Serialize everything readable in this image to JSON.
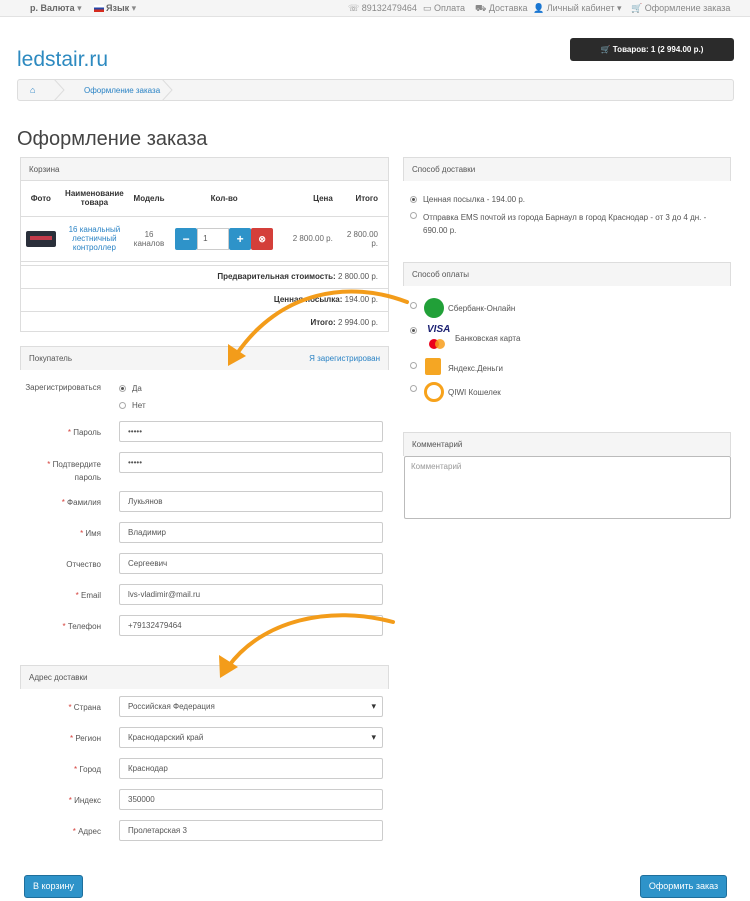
{
  "topbar": {
    "currency_label": "р. Валюта",
    "language_label": "Язык",
    "phone": "89132479464",
    "payment": "Оплата",
    "delivery": "Доставка",
    "account": "Личный кабинет",
    "checkout": "Оформление заказа"
  },
  "header": {
    "logo": "ledstair.ru",
    "cart_button": "Товаров: 1 (2 994.00 р.)"
  },
  "breadcrumb": {
    "current": "Оформление заказа"
  },
  "page_title": "Оформление заказа",
  "cart": {
    "title": "Корзина",
    "columns": [
      "Фото",
      "Наименование товара",
      "Модель",
      "Кол-во",
      "Цена",
      "Итого"
    ],
    "item": {
      "name": "16 канальный лестничный контроллер",
      "model": "16 каналов",
      "qty": "1",
      "price": "2 800.00 р.",
      "total": "2 800.00 р."
    },
    "subtotal_label": "Предварительная стоимость:",
    "subtotal_value": "2 800.00 р.",
    "shipping_label": "Ценная посылка:",
    "shipping_value": "194.00 р.",
    "total_label": "Итого:",
    "total_value": "2 994.00 р."
  },
  "buyer": {
    "title": "Покупатель",
    "registered_link": "Я зарегистрирован",
    "register_label": "Зарегистрироваться",
    "yes": "Да",
    "no": "Нет",
    "password_label": "Пароль",
    "password_value": "•••••",
    "confirm_label": "Подтвердите пароль",
    "confirm_value": "•••••",
    "lastname_label": "Фамилия",
    "lastname_value": "Лукьянов",
    "firstname_label": "Имя",
    "firstname_value": "Владимир",
    "middlename_label": "Отчество",
    "middlename_value": "Сергеевич",
    "email_label": "Email",
    "email_value": "lvs-vladimir@mail.ru",
    "phone_label": "Телефон",
    "phone_value": "+79132479464"
  },
  "address": {
    "title": "Адрес доставки",
    "country_label": "Страна",
    "country_value": "Российская Федерация",
    "region_label": "Регион",
    "region_value": "Краснодарский край",
    "city_label": "Город",
    "city_value": "Краснодар",
    "zip_label": "Индекс",
    "zip_value": "350000",
    "street_label": "Адрес",
    "street_value": "Пролетарская 3"
  },
  "shipping": {
    "title": "Способ доставки",
    "option1": "Ценная посылка - 194.00 р.",
    "option2": "Отправка EMS почтой из города Барнаул в город Краснодар - от 3 до 4 дн. - 690.00 р."
  },
  "payment": {
    "title": "Способ оплаты",
    "sber": "Сбербанк-Онлайн",
    "visa_text": "VISA",
    "card": "Банковская карта",
    "yandex": "Яндекс.Деньги",
    "qiwi": "QIWI Кошелек"
  },
  "comment": {
    "title": "Комментарий",
    "placeholder": "Комментарий"
  },
  "buttons": {
    "back": "В корзину",
    "submit": "Оформить заказ"
  },
  "colors": {
    "accent": "#2e93c9",
    "arrow": "#f39c1a",
    "danger": "#d43f3a"
  }
}
